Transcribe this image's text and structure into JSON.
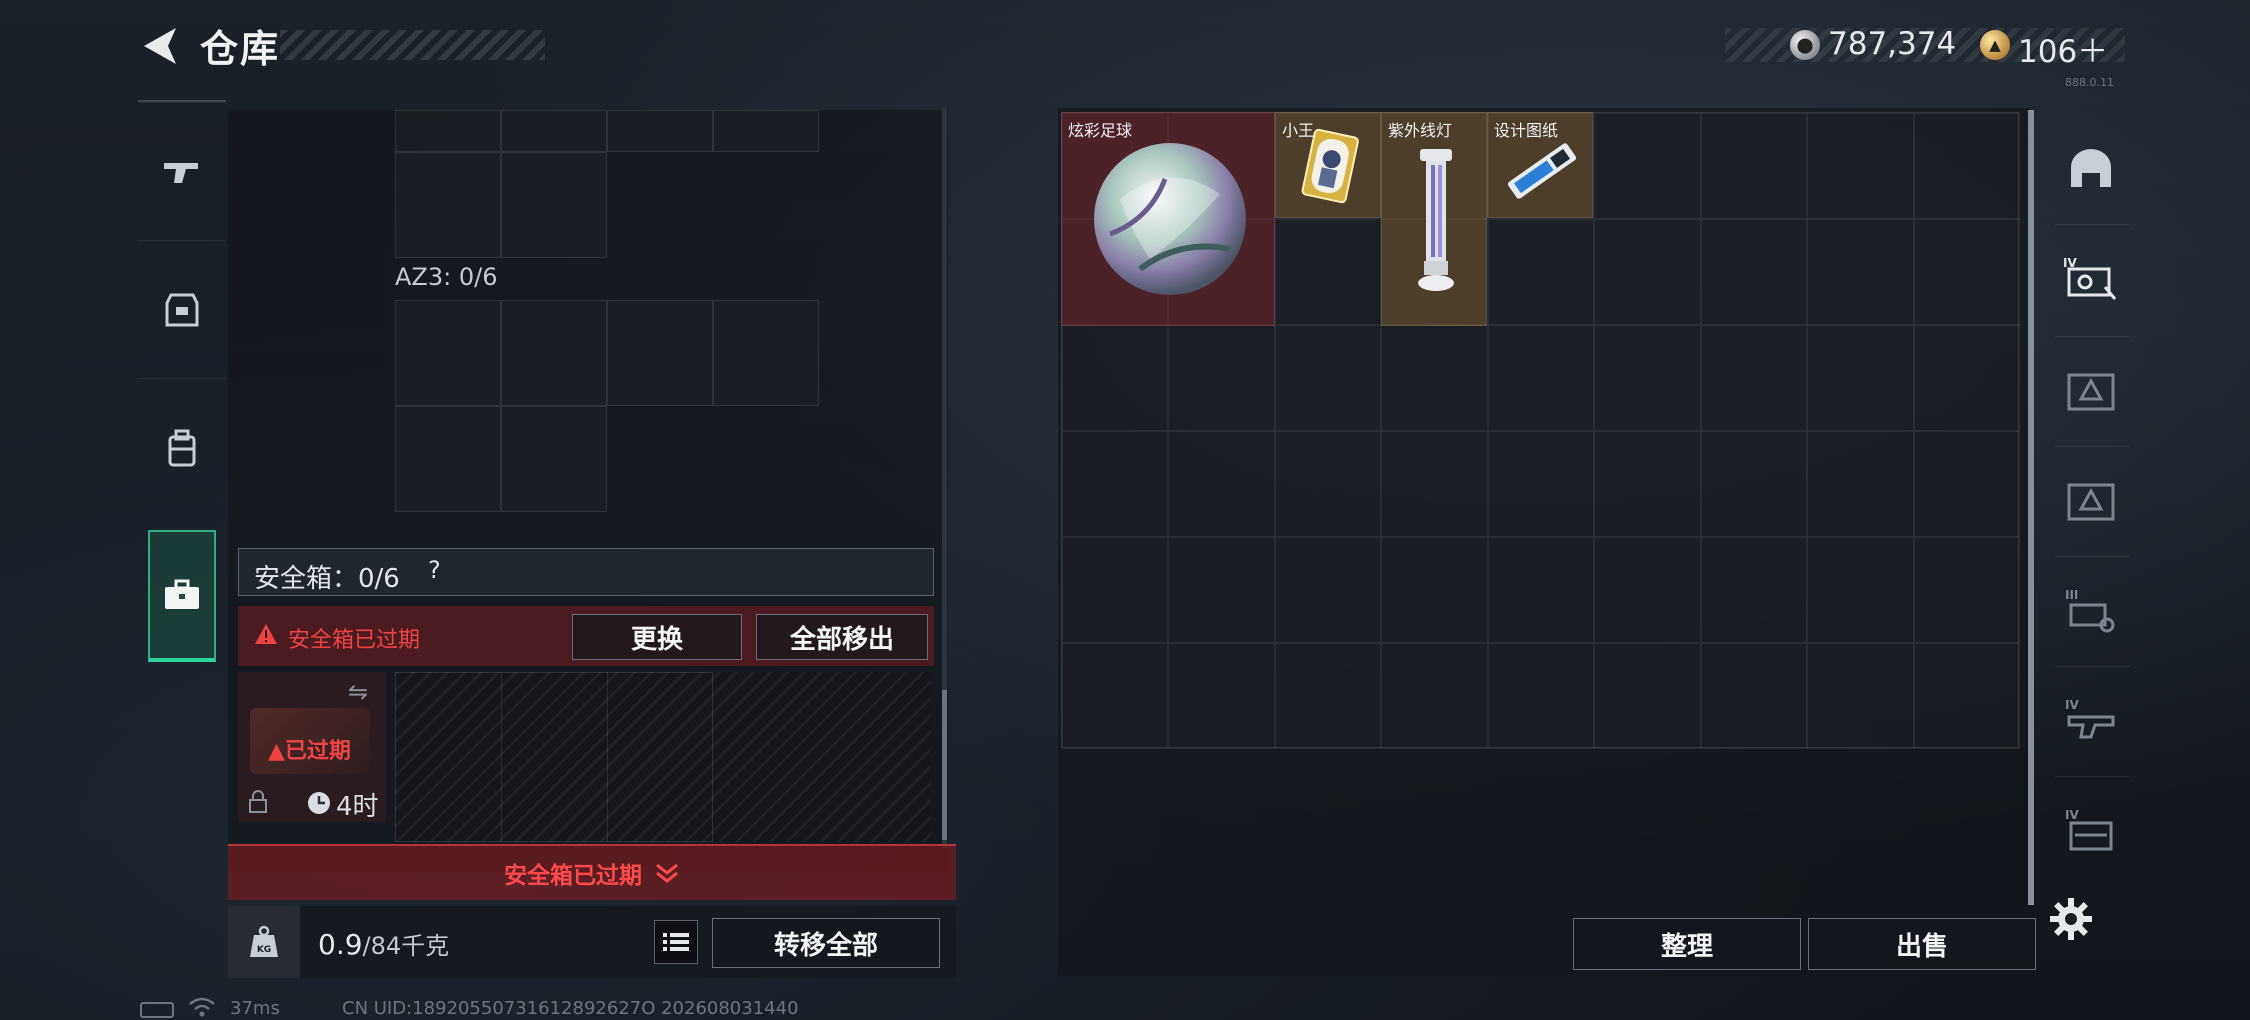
{
  "header": {
    "title": "仓库",
    "currency_primary": "787,374",
    "currency_secondary": "106＋",
    "currency_primary_icon": "silver-coin-icon",
    "currency_secondary_icon": "gold-coin-icon",
    "tiny_code": "888.0.11"
  },
  "left_rail": {
    "tabs": [
      "pistol-icon",
      "armor-icon",
      "backpack-icon",
      "briefcase-icon"
    ],
    "active_index": 3
  },
  "left_panel": {
    "az3_label": "AZ3: 0/6",
    "safebox_label": "安全箱：0/6",
    "help_symbol": "?",
    "warning_text": "安全箱已过期",
    "replace_button": "更换",
    "move_all_button": "全部移出",
    "case_expired": "已过期",
    "case_time": "4时",
    "expired_footer": "安全箱已过期",
    "weight_current": "0.9",
    "weight_max": "/84千克",
    "transfer_all_button": "转移全部"
  },
  "stash": {
    "columns": 9,
    "rows": 6,
    "items": [
      {
        "name": "炫彩足球",
        "w": 2,
        "h": 2,
        "rarity_color": "#7a2430"
      },
      {
        "name": "小王",
        "w": 1,
        "h": 1,
        "rarity_color": "#8c6432"
      },
      {
        "name": "紫外线灯",
        "w": 1,
        "h": 2,
        "rarity_color": "#8c6432"
      },
      {
        "name": "设计图纸",
        "w": 1,
        "h": 1,
        "rarity_color": "#8c6432"
      }
    ],
    "sort_button": "整理",
    "sell_button": "出售"
  },
  "right_rail": {
    "icons": [
      "helmet-icon",
      "armor-iv-icon",
      "armor-icon-2",
      "armor-icon-3",
      "gun-iii-icon",
      "gun-iv-icon",
      "gun-iv-icon-2"
    ],
    "settings_icon": "gear-icon"
  },
  "status_bar": {
    "ping": "37ms",
    "uid": "CN UID:18920550731612892627O  202608031440"
  }
}
